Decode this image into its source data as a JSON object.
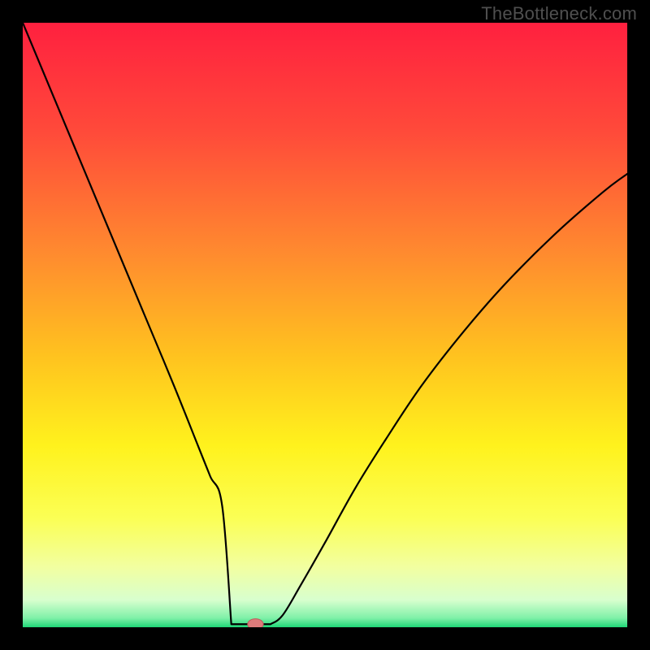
{
  "watermark": "TheBottleneck.com",
  "colors": {
    "bg_frame": "#000000",
    "curve": "#000000",
    "marker_fill": "#dd7b7b",
    "marker_stroke": "#bf5a5a",
    "gradient_stops": [
      {
        "offset": 0.0,
        "color": "#ff203f"
      },
      {
        "offset": 0.18,
        "color": "#ff4a3a"
      },
      {
        "offset": 0.38,
        "color": "#ff8a2f"
      },
      {
        "offset": 0.55,
        "color": "#ffc21f"
      },
      {
        "offset": 0.7,
        "color": "#fff21d"
      },
      {
        "offset": 0.82,
        "color": "#fbff55"
      },
      {
        "offset": 0.9,
        "color": "#f2ffa0"
      },
      {
        "offset": 0.955,
        "color": "#d8ffce"
      },
      {
        "offset": 0.985,
        "color": "#7ef0a8"
      },
      {
        "offset": 1.0,
        "color": "#1fd777"
      }
    ]
  },
  "chart_data": {
    "type": "line",
    "title": "",
    "xlabel": "",
    "ylabel": "",
    "xlim": [
      0,
      100
    ],
    "ylim": [
      0,
      100
    ],
    "grid": false,
    "series": [
      {
        "name": "bottleneck-curve",
        "x": [
          0,
          5,
          10,
          15,
          20,
          25,
          29,
          31,
          33,
          35,
          36,
          37,
          38,
          40,
          43,
          46,
          50,
          55,
          60,
          66,
          73,
          80,
          88,
          96,
          100
        ],
        "y": [
          100,
          88,
          76,
          64,
          52,
          40,
          30,
          25,
          20,
          12,
          7,
          2,
          0.5,
          0.5,
          2,
          7,
          14,
          23,
          31,
          40,
          49,
          57,
          65,
          72,
          75
        ]
      }
    ],
    "marker": {
      "x": 38.5,
      "y": 0.5,
      "rx": 1.3,
      "ry": 0.9
    },
    "flat_segment": {
      "x0": 34.5,
      "x1": 41.0,
      "y": 0.5
    }
  }
}
